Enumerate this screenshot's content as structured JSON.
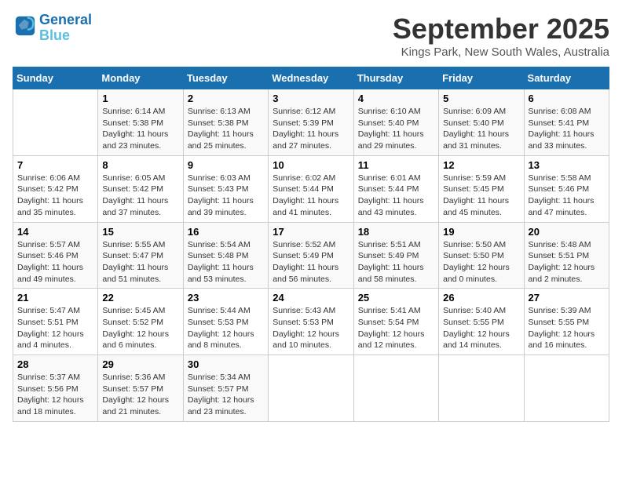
{
  "header": {
    "logo_line1": "General",
    "logo_line2": "Blue",
    "month": "September 2025",
    "location": "Kings Park, New South Wales, Australia"
  },
  "days_of_week": [
    "Sunday",
    "Monday",
    "Tuesday",
    "Wednesday",
    "Thursday",
    "Friday",
    "Saturday"
  ],
  "weeks": [
    [
      {
        "day": "",
        "sunrise": "",
        "sunset": "",
        "daylight": ""
      },
      {
        "day": "1",
        "sunrise": "Sunrise: 6:14 AM",
        "sunset": "Sunset: 5:38 PM",
        "daylight": "Daylight: 11 hours and 23 minutes."
      },
      {
        "day": "2",
        "sunrise": "Sunrise: 6:13 AM",
        "sunset": "Sunset: 5:38 PM",
        "daylight": "Daylight: 11 hours and 25 minutes."
      },
      {
        "day": "3",
        "sunrise": "Sunrise: 6:12 AM",
        "sunset": "Sunset: 5:39 PM",
        "daylight": "Daylight: 11 hours and 27 minutes."
      },
      {
        "day": "4",
        "sunrise": "Sunrise: 6:10 AM",
        "sunset": "Sunset: 5:40 PM",
        "daylight": "Daylight: 11 hours and 29 minutes."
      },
      {
        "day": "5",
        "sunrise": "Sunrise: 6:09 AM",
        "sunset": "Sunset: 5:40 PM",
        "daylight": "Daylight: 11 hours and 31 minutes."
      },
      {
        "day": "6",
        "sunrise": "Sunrise: 6:08 AM",
        "sunset": "Sunset: 5:41 PM",
        "daylight": "Daylight: 11 hours and 33 minutes."
      }
    ],
    [
      {
        "day": "7",
        "sunrise": "Sunrise: 6:06 AM",
        "sunset": "Sunset: 5:42 PM",
        "daylight": "Daylight: 11 hours and 35 minutes."
      },
      {
        "day": "8",
        "sunrise": "Sunrise: 6:05 AM",
        "sunset": "Sunset: 5:42 PM",
        "daylight": "Daylight: 11 hours and 37 minutes."
      },
      {
        "day": "9",
        "sunrise": "Sunrise: 6:03 AM",
        "sunset": "Sunset: 5:43 PM",
        "daylight": "Daylight: 11 hours and 39 minutes."
      },
      {
        "day": "10",
        "sunrise": "Sunrise: 6:02 AM",
        "sunset": "Sunset: 5:44 PM",
        "daylight": "Daylight: 11 hours and 41 minutes."
      },
      {
        "day": "11",
        "sunrise": "Sunrise: 6:01 AM",
        "sunset": "Sunset: 5:44 PM",
        "daylight": "Daylight: 11 hours and 43 minutes."
      },
      {
        "day": "12",
        "sunrise": "Sunrise: 5:59 AM",
        "sunset": "Sunset: 5:45 PM",
        "daylight": "Daylight: 11 hours and 45 minutes."
      },
      {
        "day": "13",
        "sunrise": "Sunrise: 5:58 AM",
        "sunset": "Sunset: 5:46 PM",
        "daylight": "Daylight: 11 hours and 47 minutes."
      }
    ],
    [
      {
        "day": "14",
        "sunrise": "Sunrise: 5:57 AM",
        "sunset": "Sunset: 5:46 PM",
        "daylight": "Daylight: 11 hours and 49 minutes."
      },
      {
        "day": "15",
        "sunrise": "Sunrise: 5:55 AM",
        "sunset": "Sunset: 5:47 PM",
        "daylight": "Daylight: 11 hours and 51 minutes."
      },
      {
        "day": "16",
        "sunrise": "Sunrise: 5:54 AM",
        "sunset": "Sunset: 5:48 PM",
        "daylight": "Daylight: 11 hours and 53 minutes."
      },
      {
        "day": "17",
        "sunrise": "Sunrise: 5:52 AM",
        "sunset": "Sunset: 5:49 PM",
        "daylight": "Daylight: 11 hours and 56 minutes."
      },
      {
        "day": "18",
        "sunrise": "Sunrise: 5:51 AM",
        "sunset": "Sunset: 5:49 PM",
        "daylight": "Daylight: 11 hours and 58 minutes."
      },
      {
        "day": "19",
        "sunrise": "Sunrise: 5:50 AM",
        "sunset": "Sunset: 5:50 PM",
        "daylight": "Daylight: 12 hours and 0 minutes."
      },
      {
        "day": "20",
        "sunrise": "Sunrise: 5:48 AM",
        "sunset": "Sunset: 5:51 PM",
        "daylight": "Daylight: 12 hours and 2 minutes."
      }
    ],
    [
      {
        "day": "21",
        "sunrise": "Sunrise: 5:47 AM",
        "sunset": "Sunset: 5:51 PM",
        "daylight": "Daylight: 12 hours and 4 minutes."
      },
      {
        "day": "22",
        "sunrise": "Sunrise: 5:45 AM",
        "sunset": "Sunset: 5:52 PM",
        "daylight": "Daylight: 12 hours and 6 minutes."
      },
      {
        "day": "23",
        "sunrise": "Sunrise: 5:44 AM",
        "sunset": "Sunset: 5:53 PM",
        "daylight": "Daylight: 12 hours and 8 minutes."
      },
      {
        "day": "24",
        "sunrise": "Sunrise: 5:43 AM",
        "sunset": "Sunset: 5:53 PM",
        "daylight": "Daylight: 12 hours and 10 minutes."
      },
      {
        "day": "25",
        "sunrise": "Sunrise: 5:41 AM",
        "sunset": "Sunset: 5:54 PM",
        "daylight": "Daylight: 12 hours and 12 minutes."
      },
      {
        "day": "26",
        "sunrise": "Sunrise: 5:40 AM",
        "sunset": "Sunset: 5:55 PM",
        "daylight": "Daylight: 12 hours and 14 minutes."
      },
      {
        "day": "27",
        "sunrise": "Sunrise: 5:39 AM",
        "sunset": "Sunset: 5:55 PM",
        "daylight": "Daylight: 12 hours and 16 minutes."
      }
    ],
    [
      {
        "day": "28",
        "sunrise": "Sunrise: 5:37 AM",
        "sunset": "Sunset: 5:56 PM",
        "daylight": "Daylight: 12 hours and 18 minutes."
      },
      {
        "day": "29",
        "sunrise": "Sunrise: 5:36 AM",
        "sunset": "Sunset: 5:57 PM",
        "daylight": "Daylight: 12 hours and 21 minutes."
      },
      {
        "day": "30",
        "sunrise": "Sunrise: 5:34 AM",
        "sunset": "Sunset: 5:57 PM",
        "daylight": "Daylight: 12 hours and 23 minutes."
      },
      {
        "day": "",
        "sunrise": "",
        "sunset": "",
        "daylight": ""
      },
      {
        "day": "",
        "sunrise": "",
        "sunset": "",
        "daylight": ""
      },
      {
        "day": "",
        "sunrise": "",
        "sunset": "",
        "daylight": ""
      },
      {
        "day": "",
        "sunrise": "",
        "sunset": "",
        "daylight": ""
      }
    ]
  ]
}
